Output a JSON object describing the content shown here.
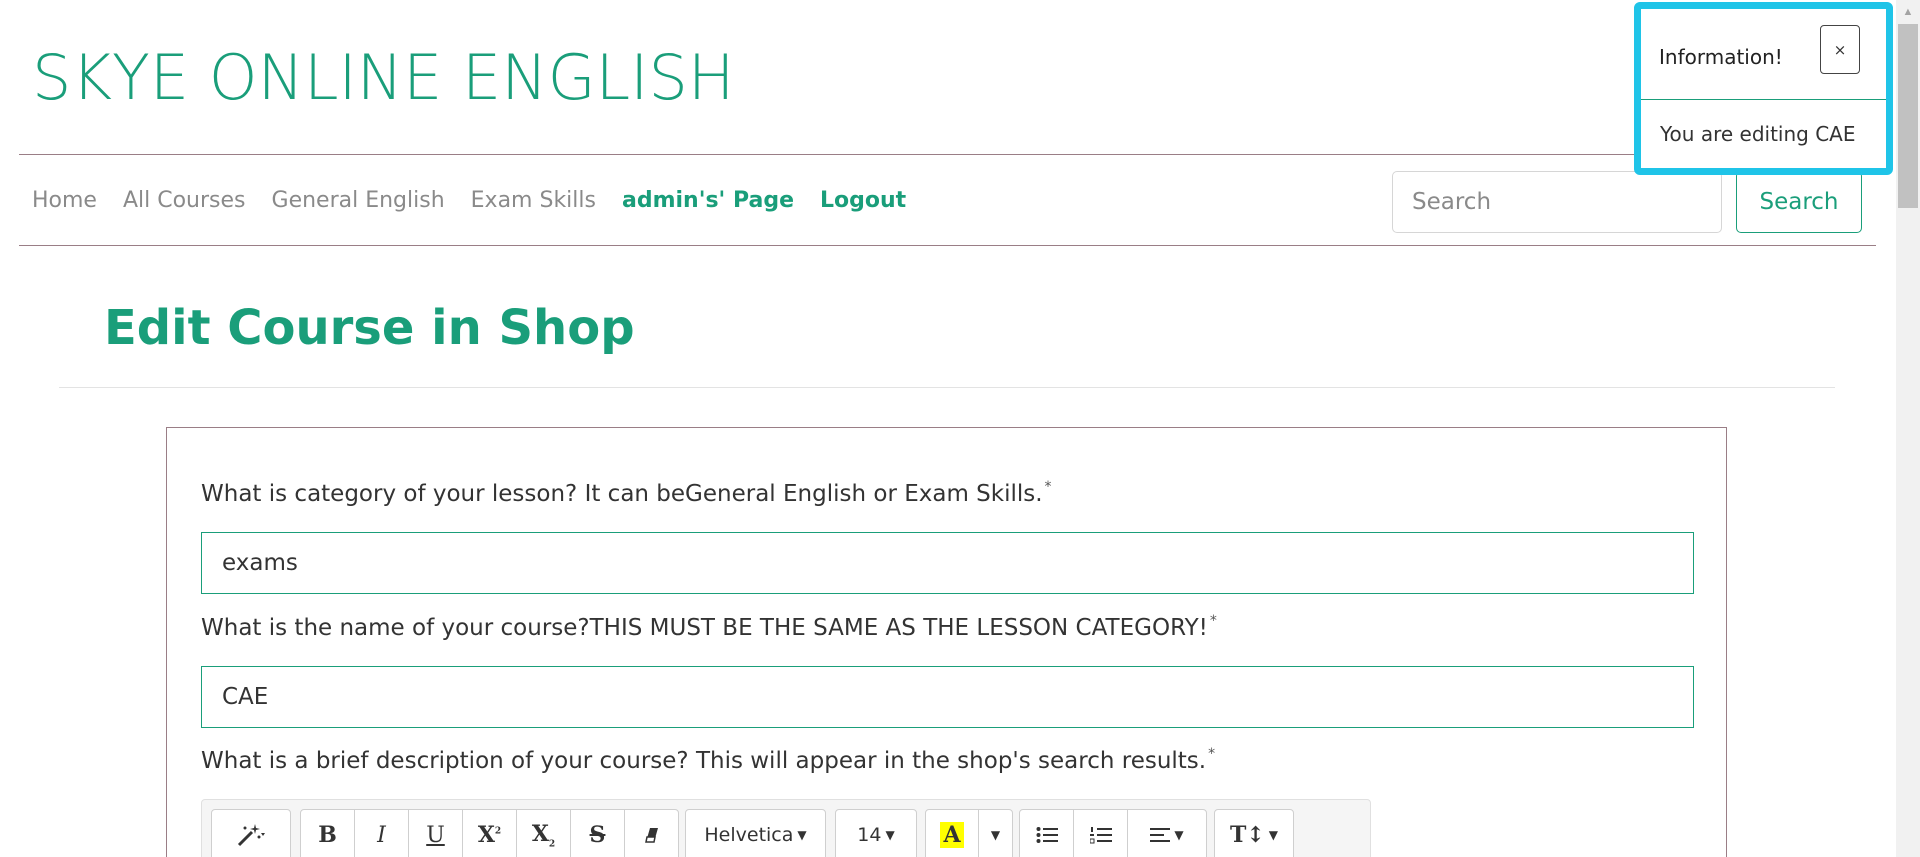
{
  "site": {
    "title": "SKYE ONLINE ENGLISH"
  },
  "nav": {
    "links": [
      "Home",
      "All Courses",
      "General English",
      "Exam Skills"
    ],
    "admin_link": "admin's' Page",
    "logout_link": "Logout",
    "search_placeholder": "Search",
    "search_button": "Search"
  },
  "page": {
    "title": "Edit Course in Shop"
  },
  "form": {
    "category_label": "What is category of your lesson? It can beGeneral English or Exam Skills.",
    "category_value": "exams",
    "name_label": "What is the name of your course?THIS MUST BE THE SAME AS THE LESSON CATEGORY!",
    "name_value": "CAE",
    "description_label": "What is a brief description of your course? This will appear in the shop's search results.",
    "required_marker": "*"
  },
  "editor_toolbar": {
    "font_name": "Helvetica",
    "font_size": "14",
    "highlight_glyph": "A",
    "icons": [
      "magic-wand-icon",
      "bold-icon",
      "italic-icon",
      "underline-icon",
      "superscript-icon",
      "subscript-icon",
      "strikethrough-icon",
      "eraser-icon",
      "highlight-color-icon",
      "unordered-list-icon",
      "ordered-list-icon",
      "align-icon",
      "line-height-icon"
    ]
  },
  "toast": {
    "title": "Information!",
    "close_label": "×",
    "message": "You are editing CAE"
  },
  "colors": {
    "accent": "#1a9e7a",
    "toast_border": "#1fc4e8",
    "rule": "#9a7e86",
    "highlight": "#ffff00"
  }
}
